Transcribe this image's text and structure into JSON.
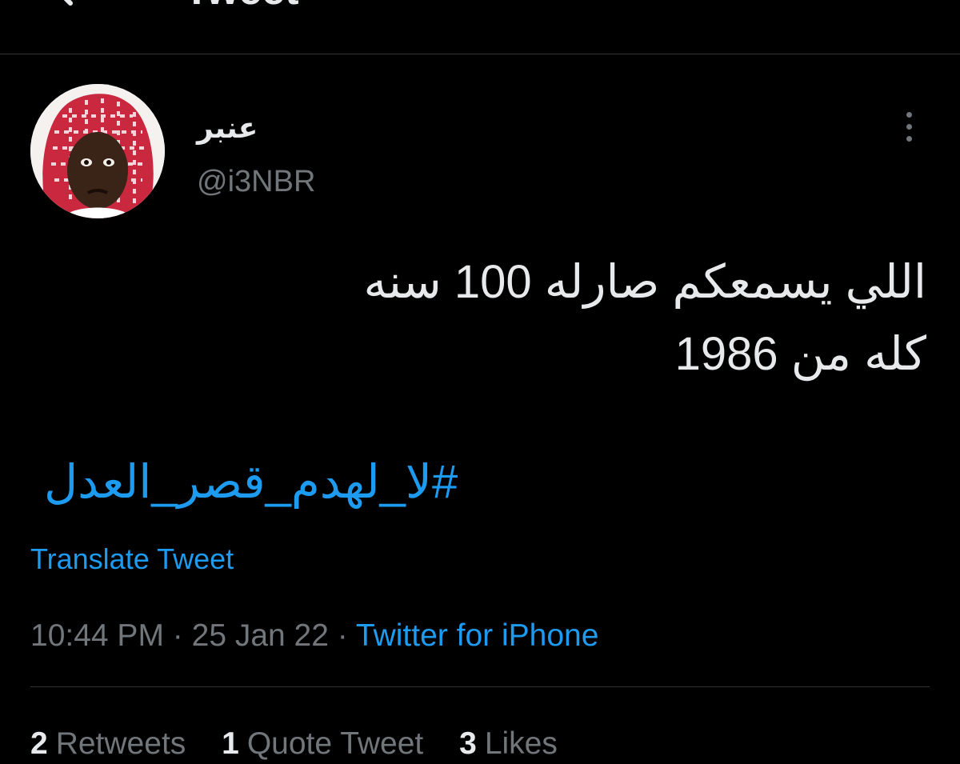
{
  "header": {
    "title": "Tweet",
    "back_icon": "arrow-left-icon"
  },
  "author": {
    "display_name": "عنبر",
    "handle": "@i3NBR",
    "avatar": "avatar"
  },
  "more_icon": "more-vertical-icon",
  "tweet": {
    "lines": [
      "اللي يسمعكم صارله 100 سنه",
      "كله من 1986"
    ],
    "hashtag": "#لا_لهدم_قصر_العدل"
  },
  "translate_label": "Translate Tweet",
  "meta": {
    "time": "10:44 PM",
    "separator": "·",
    "date": "25 Jan 22",
    "source": "Twitter for iPhone"
  },
  "stats": [
    {
      "count": "2",
      "label": "Retweets"
    },
    {
      "count": "1",
      "label": "Quote Tweet"
    },
    {
      "count": "3",
      "label": "Likes"
    }
  ],
  "colors": {
    "background": "#000000",
    "text": "#e7e9ea",
    "secondary": "#71767b",
    "link": "#1d9bf0",
    "divider": "#2f3336"
  }
}
